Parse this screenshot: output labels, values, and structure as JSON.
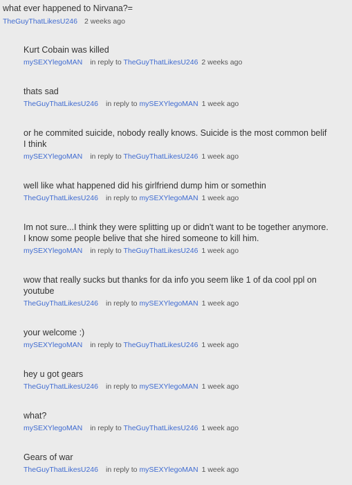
{
  "top_comment": {
    "text": "what ever happened to Nirvana?=",
    "author": "TheGuyThatLikesU246",
    "time": "2 weeks ago"
  },
  "replies": [
    {
      "text": "Kurt Cobain was killed",
      "author": "mySEXYlegoMAN",
      "in_reply_label": "in reply to",
      "reply_to": "TheGuyThatLikesU246",
      "time": "2 weeks ago"
    },
    {
      "text": "thats sad",
      "author": "TheGuyThatLikesU246",
      "in_reply_label": "in reply to",
      "reply_to": "mySEXYlegoMAN",
      "time": "1 week ago"
    },
    {
      "text": "or he commited suicide, nobody really knows. Suicide is the most common belif I think",
      "author": "mySEXYlegoMAN",
      "in_reply_label": "in reply to",
      "reply_to": "TheGuyThatLikesU246",
      "time": "1 week ago"
    },
    {
      "text": "well like what happened did his girlfriend dump him or somethin",
      "author": "TheGuyThatLikesU246",
      "in_reply_label": "in reply to",
      "reply_to": "mySEXYlegoMAN",
      "time": "1 week ago"
    },
    {
      "text": "Im not sure...I think they were splitting up or didn't want to be together anymore. I know some people belive that she hired someone to kill him.",
      "author": "mySEXYlegoMAN",
      "in_reply_label": "in reply to",
      "reply_to": "TheGuyThatLikesU246",
      "time": "1 week ago"
    },
    {
      "text": "wow that really sucks but thanks for da info you seem like 1 of da cool ppl on youtube",
      "author": "TheGuyThatLikesU246",
      "in_reply_label": "in reply to",
      "reply_to": "mySEXYlegoMAN",
      "time": "1 week ago"
    },
    {
      "text": "your welcome :)",
      "author": "mySEXYlegoMAN",
      "in_reply_label": "in reply to",
      "reply_to": "TheGuyThatLikesU246",
      "time": "1 week ago"
    },
    {
      "text": "hey u got gears",
      "author": "TheGuyThatLikesU246",
      "in_reply_label": "in reply to",
      "reply_to": "mySEXYlegoMAN",
      "time": "1 week ago"
    },
    {
      "text": "what?",
      "author": "mySEXYlegoMAN",
      "in_reply_label": "in reply to",
      "reply_to": "TheGuyThatLikesU246",
      "time": "1 week ago"
    },
    {
      "text": "Gears of war",
      "author": "TheGuyThatLikesU246",
      "in_reply_label": "in reply to",
      "reply_to": "mySEXYlegoMAN",
      "time": "1 week ago"
    }
  ],
  "colors": {
    "background": "#ebebeb",
    "text": "#333333",
    "link": "#3f6bd1",
    "meta": "#555555"
  }
}
